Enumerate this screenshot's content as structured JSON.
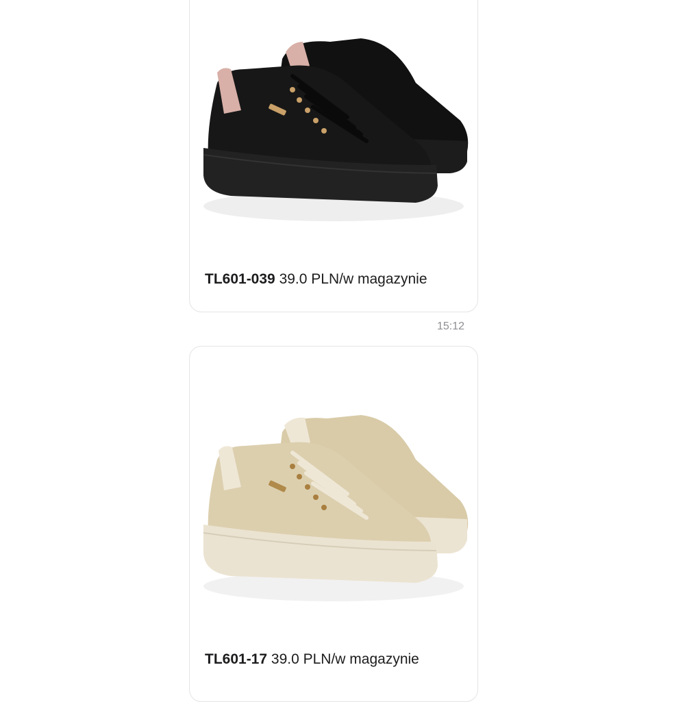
{
  "messages": [
    {
      "product_code": "TL601-039",
      "price_text": "39.0 PLN/w magazynie",
      "image": "black-platform-sneakers-photo",
      "colors": {
        "upper": "#151515",
        "heel_tab": "#d8b0a8",
        "eyelets": "#c9a169"
      }
    },
    {
      "timestamp": "15:12"
    },
    {
      "product_code": "TL601-17",
      "price_text": "39.0 PLN/w magazynie",
      "image": "gold-platform-sneakers-photo",
      "colors": {
        "upper": "#dccfae",
        "sole": "#ebe3d1",
        "eyelets": "#a97f3f"
      }
    }
  ]
}
